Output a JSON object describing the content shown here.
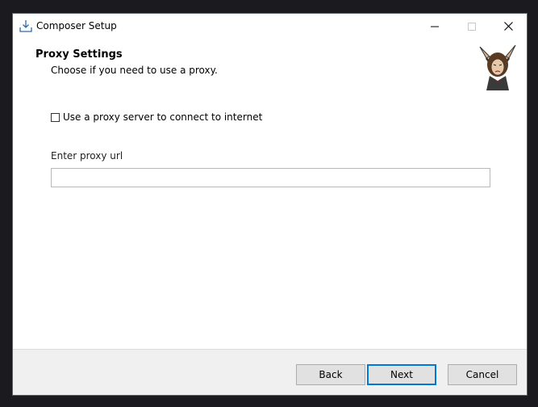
{
  "window": {
    "title": "Composer Setup",
    "icons": {
      "app": "installer-download-icon",
      "minimize": "minimize-icon",
      "maximize": "maximize-icon",
      "close": "close-icon"
    }
  },
  "page": {
    "heading": "Proxy Settings",
    "subheading": "Choose if you need to use a proxy."
  },
  "proxy": {
    "checkbox_label": "Use a proxy server to connect to internet",
    "checked": false,
    "url_label": "Enter proxy url",
    "url_value": ""
  },
  "buttons": {
    "back": "Back",
    "next": "Next",
    "cancel": "Cancel"
  },
  "colors": {
    "accent": "#0078d7",
    "footer_bg": "#f0f0f0",
    "button_bg": "#e1e1e1"
  }
}
